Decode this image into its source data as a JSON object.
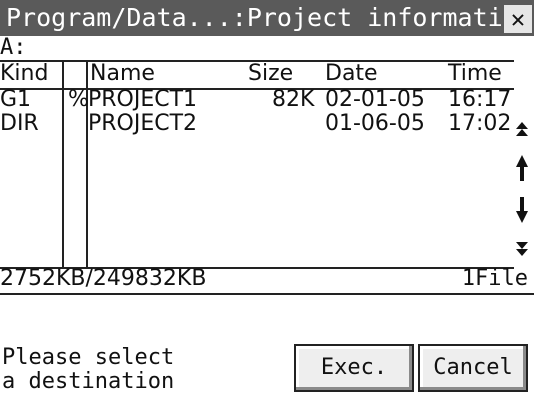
{
  "window": {
    "title": "Program/Data...:Project information",
    "close_label": "✕"
  },
  "drive": "A:",
  "table": {
    "headers": {
      "kind": "Kind",
      "name": "Name",
      "size": "Size",
      "date": "Date",
      "time": "Time"
    },
    "rows": [
      {
        "kind": "G1",
        "flag": "%",
        "name": "PROJECT1",
        "size": "82K",
        "date": "02-01-05",
        "time": "16:17"
      },
      {
        "kind": "DIR",
        "flag": "",
        "name": "PROJECT2",
        "size": "",
        "date": "01-06-05",
        "time": "17:02"
      }
    ]
  },
  "scrollbar": {
    "icons": [
      "double-up-arrow-icon",
      "up-arrow-icon",
      "down-arrow-icon",
      "double-down-arrow-icon"
    ]
  },
  "footer": {
    "usage": "2752KB/249832KB",
    "file_count": "1File"
  },
  "prompt": {
    "line1": "Please select",
    "line2": "a destination"
  },
  "buttons": {
    "exec": "Exec.",
    "cancel": "Cancel"
  },
  "colors": {
    "titlebar_bg": "#5a5a5a",
    "titlebar_text": "#ffffff",
    "background": "#ffffff"
  }
}
